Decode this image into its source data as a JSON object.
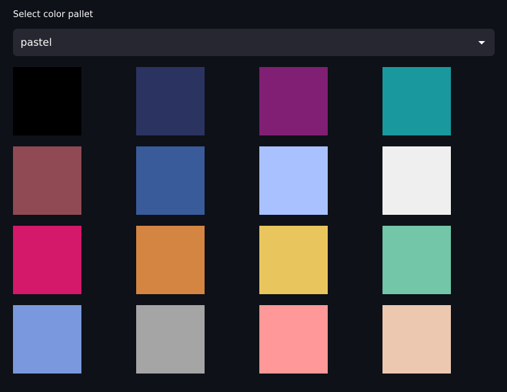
{
  "selector": {
    "label": "Select color pallet",
    "value": "pastel",
    "icon": "chevron-down-icon"
  },
  "palette": {
    "swatches": [
      "#000000",
      "#2b3361",
      "#801f73",
      "#19989e",
      "#8f4a53",
      "#3a5b9a",
      "#a9c1fe",
      "#efefef",
      "#d4186a",
      "#d48542",
      "#e9c65d",
      "#73c6a8",
      "#7a98dd",
      "#a5a5a5",
      "#ff9898",
      "#ecc8b1"
    ]
  }
}
